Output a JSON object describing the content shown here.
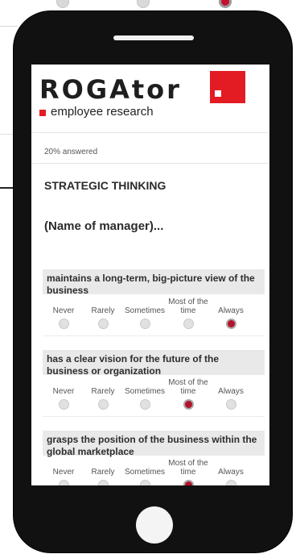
{
  "brand": {
    "logo_text": "ROGAtor",
    "tagline": "employee research",
    "accent_color": "#e31b23",
    "selected_radio_color": "#b5122b"
  },
  "progress": {
    "text": "20% answered",
    "fraction": 0.2
  },
  "section_title": "STRATEGIC THINKING",
  "subject_line": "(Name of manager)...",
  "scale_options": [
    {
      "label": "Never"
    },
    {
      "label": "Rarely"
    },
    {
      "label": "Sometimes"
    },
    {
      "label": "Most of the time"
    },
    {
      "label": "Always"
    }
  ],
  "questions": [
    {
      "text": "maintains a long-term, big-picture view of the business",
      "selected": "Always"
    },
    {
      "text": "has a clear vision for the future of the business or organization",
      "selected": "Most of the time"
    },
    {
      "text": "grasps the position of the business within the global marketplace",
      "selected": "Most of the time"
    }
  ]
}
